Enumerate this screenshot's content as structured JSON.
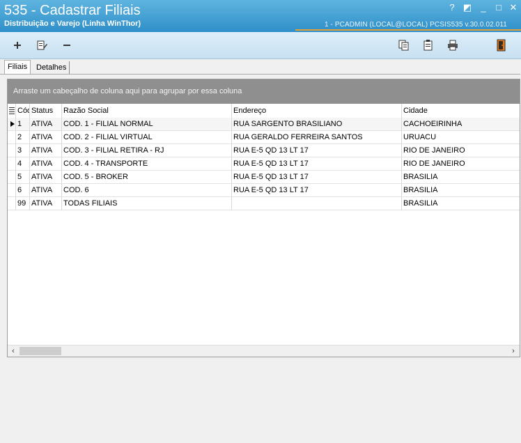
{
  "window": {
    "title": "535 - Cadastrar Filiais",
    "subtitle": "Distribuição e Varejo (Linha WinThor)",
    "session": "1 - PCADMIN (LOCAL@LOCAL)   PCSIS535  v.30.0.02.011",
    "help_glyph": "?",
    "restore_glyph": "◩",
    "minimize_glyph": "_",
    "maximize_glyph": "□",
    "close_glyph": "✕"
  },
  "toolbar": {
    "icons": [
      "add-icon",
      "edit-icon",
      "remove-icon",
      "copy-icon",
      "clipboard-icon",
      "print-icon",
      "exit-icon"
    ]
  },
  "tabs": [
    {
      "label": "Filiais",
      "active": true
    },
    {
      "label": "Detalhes",
      "active": false
    }
  ],
  "grid": {
    "group_hint": "Arraste um cabeçalho de coluna aqui para agrupar por essa coluna",
    "columns": [
      "Cód",
      "Status",
      "Razão Social",
      "Endereço",
      "Cidade"
    ],
    "rows": [
      {
        "cod": "1",
        "status": "ATIVA",
        "razao": "COD. 1 - FILIAL NORMAL",
        "endereco": "RUA SARGENTO BRASILIANO",
        "cidade": "CACHOEIRINHA"
      },
      {
        "cod": "2",
        "status": "ATIVA",
        "razao": "COD. 2 - FILIAL VIRTUAL",
        "endereco": "RUA GERALDO FERREIRA SANTOS",
        "cidade": "URUACU"
      },
      {
        "cod": "3",
        "status": "ATIVA",
        "razao": "COD. 3 - FILIAL RETIRA - RJ",
        "endereco": "RUA E-5 QD 13 LT 17",
        "cidade": "RIO DE JANEIRO"
      },
      {
        "cod": "4",
        "status": "ATIVA",
        "razao": "COD. 4 - TRANSPORTE",
        "endereco": "RUA E-5 QD 13 LT 17",
        "cidade": "RIO DE JANEIRO"
      },
      {
        "cod": "5",
        "status": "ATIVA",
        "razao": "COD. 5 - BROKER",
        "endereco": "RUA E-5 QD 13 LT 17",
        "cidade": "BRASILIA"
      },
      {
        "cod": "6",
        "status": "ATIVA",
        "razao": "COD. 6",
        "endereco": "RUA E-5 QD 13 LT 17",
        "cidade": "BRASILIA"
      },
      {
        "cod": "99",
        "status": "ATIVA",
        "razao": "TODAS FILIAIS",
        "endereco": "",
        "cidade": "BRASILIA"
      }
    ],
    "selected_row": 0,
    "scroll_left": "‹",
    "scroll_right": "›"
  }
}
